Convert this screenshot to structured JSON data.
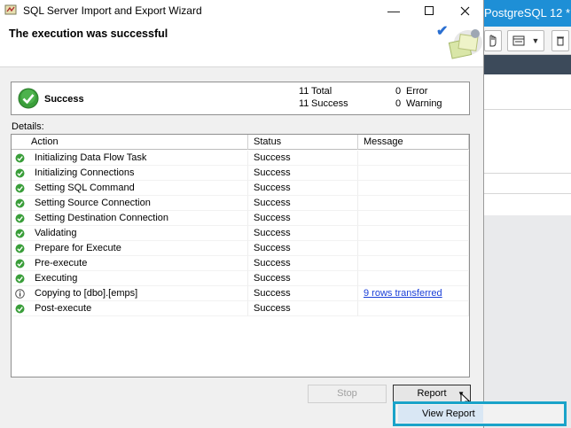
{
  "background_app": {
    "title": "PostgreSQL 12 *"
  },
  "window": {
    "title": "SQL Server Import and Export Wizard"
  },
  "header": {
    "title": "The execution was successful"
  },
  "summary": {
    "status": "Success",
    "total_count": "11",
    "total_label": "Total",
    "success_count": "11",
    "success_label": "Success",
    "error_count": "0",
    "error_label": "Error",
    "warning_count": "0",
    "warning_label": "Warning"
  },
  "details_label": "Details:",
  "table": {
    "columns": [
      "Action",
      "Status",
      "Message"
    ],
    "rows": [
      {
        "icon": "success",
        "action": "Initializing Data Flow Task",
        "status": "Success",
        "message": ""
      },
      {
        "icon": "success",
        "action": "Initializing Connections",
        "status": "Success",
        "message": ""
      },
      {
        "icon": "success",
        "action": "Setting SQL Command",
        "status": "Success",
        "message": ""
      },
      {
        "icon": "success",
        "action": "Setting Source Connection",
        "status": "Success",
        "message": ""
      },
      {
        "icon": "success",
        "action": "Setting Destination Connection",
        "status": "Success",
        "message": ""
      },
      {
        "icon": "success",
        "action": "Validating",
        "status": "Success",
        "message": ""
      },
      {
        "icon": "success",
        "action": "Prepare for Execute",
        "status": "Success",
        "message": ""
      },
      {
        "icon": "success",
        "action": "Pre-execute",
        "status": "Success",
        "message": ""
      },
      {
        "icon": "success",
        "action": "Executing",
        "status": "Success",
        "message": ""
      },
      {
        "icon": "info",
        "action": "Copying to [dbo].[emps]",
        "status": "Success",
        "message": "9 rows transferred"
      },
      {
        "icon": "success",
        "action": "Post-execute",
        "status": "Success",
        "message": ""
      }
    ]
  },
  "buttons": {
    "stop": "Stop",
    "report": "Report"
  },
  "report_menu": {
    "view_report": "View Report"
  },
  "colors": {
    "success_green": "#3a9e3a",
    "accent_blue": "#1e8fd6",
    "highlight_cyan": "#1aa3c9"
  }
}
